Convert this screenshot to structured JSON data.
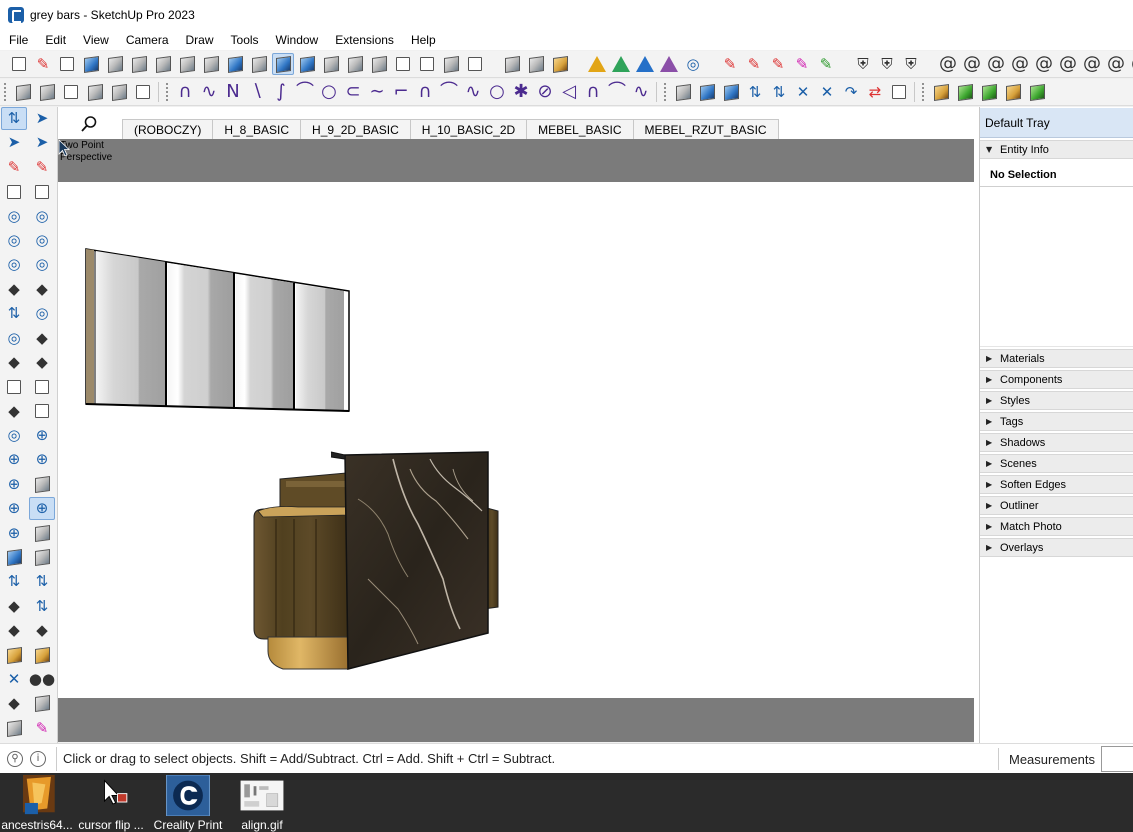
{
  "window": {
    "title": "grey bars - SketchUp Pro 2023",
    "app_icon": "sketchup-icon"
  },
  "menu": [
    "File",
    "Edit",
    "View",
    "Camera",
    "Draw",
    "Tools",
    "Window",
    "Extensions",
    "Help"
  ],
  "toolbar1": {
    "groups": [
      [
        "new-file-icon",
        "open-folder-icon",
        "save-icon",
        "iso-view-icon",
        "top-view-icon",
        "front-view-icon",
        "right-view-icon",
        "back-view-icon",
        "left-view-icon",
        "xray-icon",
        "wireframe-icon",
        "shaded-icon",
        "shaded-textures-icon",
        "monochrome-icon",
        "section-plane-icon",
        "box-icon",
        "house-icon",
        "dimension-icon",
        "section-cut-icon",
        "tag-icon"
      ],
      [
        "extension-cube-icon",
        "extension-cube-white-icon",
        "extension-cube-beige-icon"
      ],
      [
        "house-gold-icon",
        "house-green-icon",
        "house-blue-icon",
        "house-purple-icon",
        "refresh-badge-icon"
      ],
      [
        "pen-icon",
        "pen-plus-icon",
        "pen-edit-icon",
        "pen-magenta-icon",
        "pen-green-icon"
      ],
      [
        "shield-icon",
        "bell-icon",
        "tent-icon"
      ],
      [
        "spiral-1-icon",
        "spiral-2-icon",
        "spiral-3-icon",
        "spiral-4-icon",
        "spiral-5-icon",
        "spiral-6-icon",
        "spiral-7-icon",
        "spiral-8-icon",
        "spiral-9-icon"
      ],
      [
        "arch-icon"
      ]
    ]
  },
  "toolbar2": {
    "groups": [
      [
        "checkbox-icon",
        "checkbox-checked-icon",
        "cloud-upload-icon",
        "warehouse-icon",
        "ext-warehouse-icon",
        "send-icon"
      ],
      [
        "curve-1-icon",
        "curve-2-icon",
        "curve-3-icon",
        "curve-4-icon",
        "curve-5-icon",
        "curve-6-icon",
        "curve-7-icon",
        "curve-8-icon",
        "curve-9-icon",
        "curve-10-icon",
        "curve-11-icon",
        "curve-12-icon",
        "curve-13-icon",
        "curve-14-icon",
        "curve-15-icon",
        "curve-16-icon",
        "curve-17-icon",
        "curve-18-icon",
        "curve-19-icon",
        "curve-20-icon"
      ],
      [
        "cube-select-icon",
        "cube-blue-icon",
        "blue-bar-icon",
        "up-down-arrows-icon",
        "red-arrows-icon",
        "diagonal-icon",
        "x-shape-icon",
        "hook-blue-icon",
        "hook-red-icon",
        "flag-icon"
      ],
      [
        "cube-gold-icon",
        "cube-green-icon",
        "cube-green2-icon",
        "tools-gold-icon",
        "gear-green-icon"
      ]
    ]
  },
  "left_toolbar": [
    "select-arrow-icon",
    "lasso-icon",
    "paint-bucket-icon",
    "eraser-icon",
    "pencil-icon",
    "freehand-icon",
    "rectangle-icon",
    "rotated-rectangle-icon",
    "circle-icon",
    "polygon-icon",
    "arc-icon",
    "pie-icon",
    "two-point-arc-icon",
    "three-point-arc-icon",
    "push-pull-icon",
    "follow-me-icon",
    "move-icon",
    "offset-icon",
    "rotate-icon",
    "scale-icon",
    "tape-measure-icon",
    "protractor-icon",
    "dimension-icon",
    "text-icon",
    "axes-icon",
    "three-d-text-icon",
    "orbit-icon",
    "pan-icon",
    "zoom-icon",
    "zoom-window-icon",
    "zoom-extents-icon",
    "previous-view-icon",
    "walk-icon",
    "look-around-icon",
    "position-camera-icon",
    "section-plane-icon",
    "xray-toggle-icon",
    "sphere-icon",
    "axis-arrow-icon",
    "move-up-icon",
    "bar-chart-icon",
    "move-down-icon",
    "blue-line-icon",
    "green-plane-icon",
    "brown-box-icon",
    "brown-box-n-icon",
    "cut-icon",
    "dots-icon",
    "tape-icon",
    "cube-empty-icon",
    "cube-half-icon",
    "pen-magenta-icon",
    "plane-icon",
    "sliders-icon",
    "green-cube-icon"
  ],
  "scene_tabs": [
    "(ROBOCZY)",
    "H_8_BASIC",
    "H_9_2D_BASIC",
    "H_10_BASIC_2D",
    "MEBEL_BASIC",
    "MEBEL_RZUT_BASIC"
  ],
  "viewport": {
    "camera_label": "Two Point Perspective"
  },
  "tray": {
    "title": "Default Tray",
    "entity_info": {
      "label": "Entity Info",
      "selection": "No Selection"
    },
    "panels": [
      "Materials",
      "Components",
      "Styles",
      "Tags",
      "Shadows",
      "Scenes",
      "Soften Edges",
      "Outliner",
      "Match Photo",
      "Overlays"
    ]
  },
  "status": {
    "text": "Click or drag to select objects. Shift = Add/Subtract. Ctrl = Add. Shift + Ctrl = Subtract.",
    "measurements_label": "Measurements",
    "measurements_value": ""
  },
  "taskbar": [
    {
      "label": "ancestris64..."
    },
    {
      "label": "cursor flip ..."
    },
    {
      "label": "Creality Print"
    },
    {
      "label": "align.gif"
    }
  ],
  "colors": {
    "viewport_band": "#7b7b7b",
    "tray_title_bg": "#d9e6f5",
    "taskbar_bg": "#2b2b2b",
    "marble": "#2c251d",
    "wood": "#5a4628",
    "brass": "#c89a4a"
  }
}
